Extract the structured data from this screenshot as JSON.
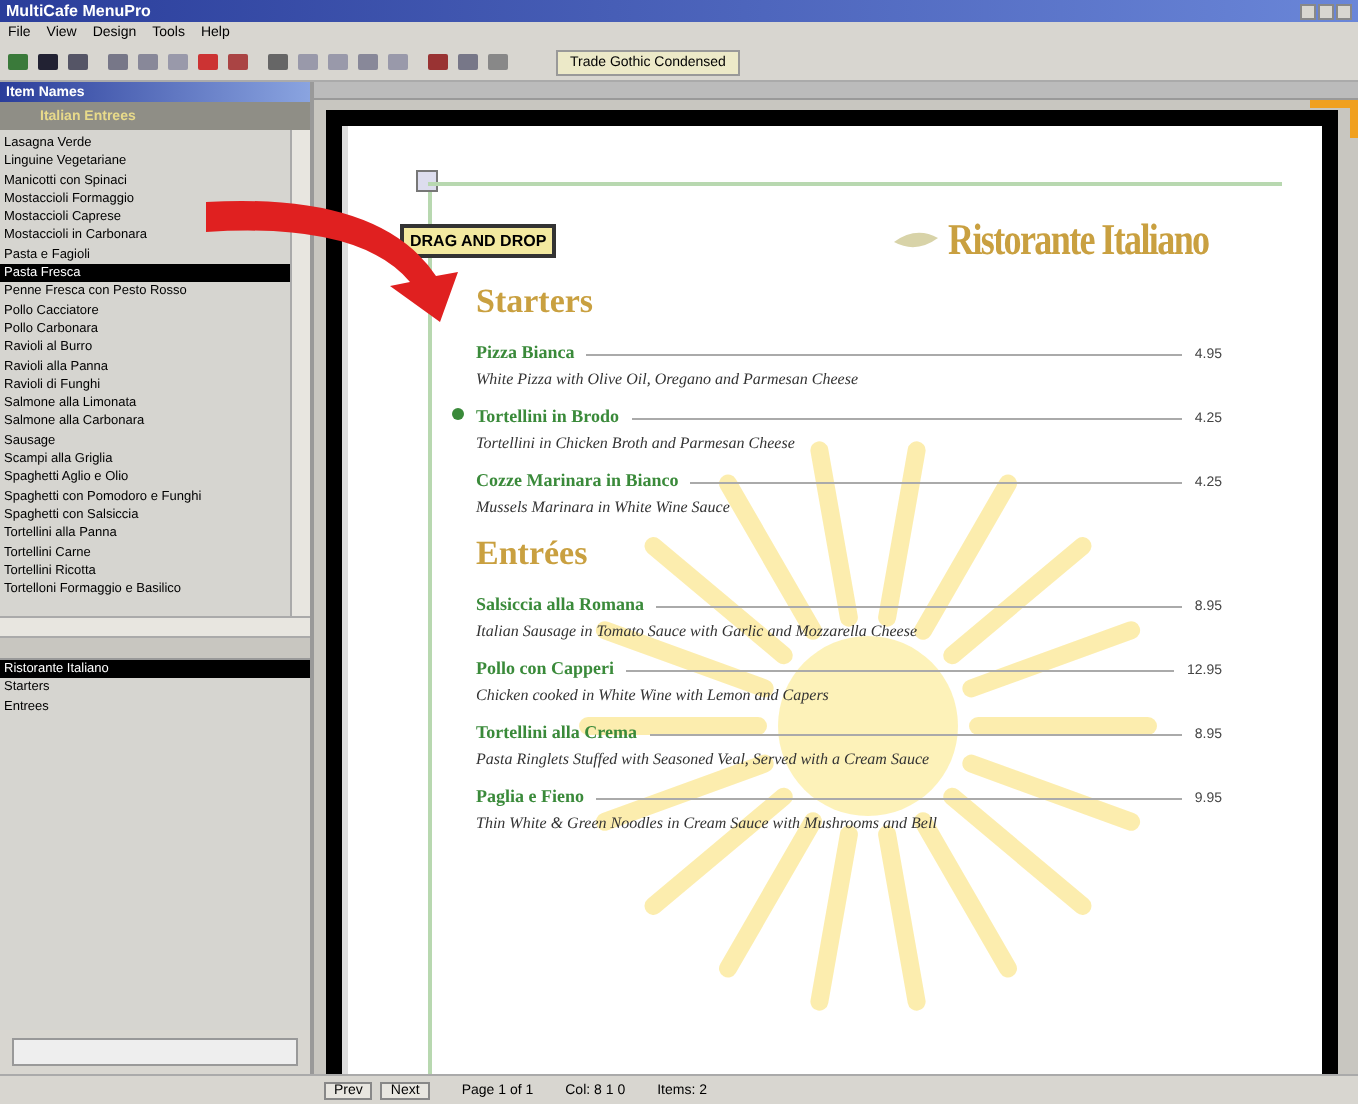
{
  "window": {
    "title": "MultiCafe MenuPro"
  },
  "menu_bar": [
    "File",
    "View",
    "Design",
    "Tools",
    "Help"
  ],
  "toolbar": {
    "font_field": "Trade Gothic Condensed"
  },
  "item_panel": {
    "title": "Item Names",
    "category": "Italian Entrees",
    "items": [
      {
        "label": "Lasagna Verde",
        "selected": false
      },
      {
        "label": "Linguine Vegetariane",
        "selected": false
      },
      {
        "label": "Manicotti con Spinaci",
        "selected": false
      },
      {
        "label": "Mostaccioli Formaggio",
        "selected": false
      },
      {
        "label": "Mostaccioli Caprese",
        "selected": false
      },
      {
        "label": "Mostaccioli in Carbonara",
        "selected": false
      },
      {
        "label": "Pasta e Fagioli",
        "selected": false
      },
      {
        "label": "Pasta Fresca",
        "selected": true
      },
      {
        "label": "Penne Fresca con Pesto Rosso",
        "selected": false
      },
      {
        "label": "Pollo Cacciatore",
        "selected": false
      },
      {
        "label": "Pollo Carbonara",
        "selected": false
      },
      {
        "label": "Ravioli al Burro",
        "selected": false
      },
      {
        "label": "Ravioli alla Panna",
        "selected": false
      },
      {
        "label": "Ravioli di Funghi",
        "selected": false
      },
      {
        "label": "Salmone alla Limonata",
        "selected": false
      },
      {
        "label": "Salmone alla Carbonara",
        "selected": false
      },
      {
        "label": "Sausage",
        "selected": false
      },
      {
        "label": "Scampi alla Griglia",
        "selected": false
      },
      {
        "label": "Spaghetti Aglio e Olio",
        "selected": false
      },
      {
        "label": "Spaghetti con Pomodoro e Funghi",
        "selected": false
      },
      {
        "label": "Spaghetti con Salsiccia",
        "selected": false
      },
      {
        "label": "Tortellini alla Panna",
        "selected": false
      },
      {
        "label": "Tortellini Carne",
        "selected": false
      },
      {
        "label": "Tortellini Ricotta",
        "selected": false
      },
      {
        "label": "Tortelloni Formaggio e Basilico",
        "selected": false
      }
    ]
  },
  "layout_panel": {
    "items": [
      {
        "label": "Ristorante Italiano",
        "selected": true
      },
      {
        "label": "Starters",
        "selected": false
      },
      {
        "label": "Entrees",
        "selected": false
      }
    ]
  },
  "document": {
    "callout": "DRAG AND DROP",
    "title": "Ristorante Italiano",
    "sections": [
      {
        "heading": "Starters",
        "items": [
          {
            "name": "Pizza Bianca",
            "price": "4.95",
            "description": "White Pizza with Olive Oil, Oregano and Parmesan Cheese",
            "marked": false
          },
          {
            "name": "Tortellini in Brodo",
            "price": "4.25",
            "description": "Tortellini in Chicken Broth and Parmesan Cheese",
            "marked": true
          },
          {
            "name": "Cozze Marinara in Bianco",
            "price": "4.25",
            "description": "Mussels Marinara in White Wine Sauce",
            "marked": false
          }
        ]
      },
      {
        "heading": "Entrées",
        "items": [
          {
            "name": "Salsiccia alla Romana",
            "price": "8.95",
            "description": "Italian Sausage in Tomato Sauce with Garlic and Mozzarella Cheese",
            "marked": false
          },
          {
            "name": "Pollo con Capperi",
            "price": "12.95",
            "description": "Chicken cooked in White Wine with Lemon and Capers",
            "marked": false
          },
          {
            "name": "Tortellini alla Crema",
            "price": "8.95",
            "description": "Pasta Ringlets Stuffed with Seasoned Veal, Served with a Cream Sauce",
            "marked": false
          },
          {
            "name": "Paglia e Fieno",
            "price": "9.95",
            "description": "Thin White & Green Noodles in Cream Sauce with Mushrooms and Bell",
            "marked": false
          }
        ]
      }
    ]
  },
  "status_bar": {
    "buttons": [
      "Prev",
      "Next"
    ],
    "fields": [
      "Page 1 of 1",
      "Col: 8 1 0",
      "Items: 2"
    ]
  }
}
